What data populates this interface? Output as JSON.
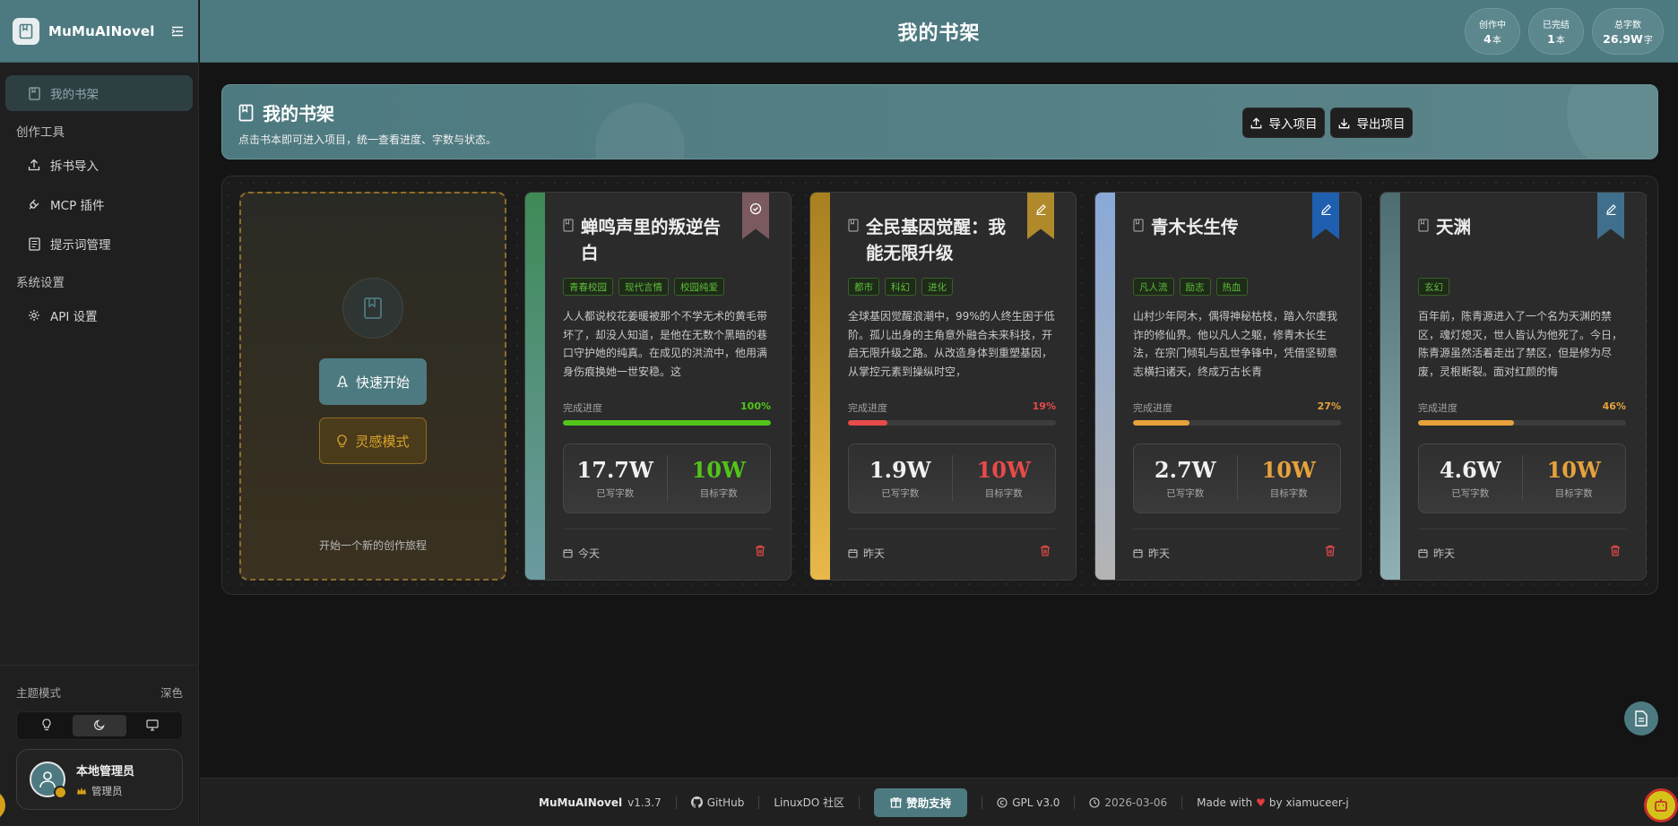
{
  "app": {
    "name": "MuMuAINovel"
  },
  "colors": {
    "primary": "#4d7a80",
    "gold": "#d9a22c",
    "green": "#52c41a",
    "red": "#e84a4a",
    "orange": "#e6a23c"
  },
  "sidebar": {
    "active": {
      "label": "我的书架",
      "icon": "book-icon"
    },
    "groups": [
      {
        "title": "创作工具",
        "items": [
          {
            "label": "拆书导入",
            "icon": "upload-icon"
          },
          {
            "label": "MCP 插件",
            "icon": "plug-icon"
          },
          {
            "label": "提示词管理",
            "icon": "document-icon"
          }
        ]
      },
      {
        "title": "系统设置",
        "items": [
          {
            "label": "API 设置",
            "icon": "gear-icon"
          }
        ]
      }
    ],
    "theme": {
      "label": "主题模式",
      "value": "深色",
      "options": [
        "light-icon",
        "moon-icon",
        "monitor-icon"
      ],
      "selected": 1
    },
    "user": {
      "name": "本地管理员",
      "role": "管理员"
    }
  },
  "header": {
    "title": "我的书架",
    "stats": [
      {
        "label": "创作中",
        "value": "4",
        "unit": "本"
      },
      {
        "label": "已完结",
        "value": "1",
        "unit": "本"
      },
      {
        "label": "总字数",
        "value": "26.9W",
        "unit": "字"
      }
    ]
  },
  "banner": {
    "title": "我的书架",
    "subtitle": "点击书本即可进入项目，统一查看进度、字数与状态。",
    "import_label": "导入项目",
    "export_label": "导出项目"
  },
  "new_card": {
    "quick_start": "快速开始",
    "inspiration": "灵感模式",
    "caption": "开始一个新的创作旅程"
  },
  "books": [
    {
      "title": "蝉鸣声里的叛逆告白",
      "tags": [
        "青春校园",
        "现代言情",
        "校园纯爱"
      ],
      "description": "人人都说校花姜暖被那个不学无术的黄毛带坏了，却没人知道，是他在无数个黑暗的巷口守护她的纯真。在成见的洪流中，他用满身伤痕换她一世安稳。这",
      "progress_label": "完成进度",
      "progress_text": "100%",
      "progress": 1.0,
      "progress_color": "#52c41a",
      "written": "17.7W",
      "written_label": "已写字数",
      "target": "10W",
      "target_label": "目标字数",
      "target_color": "#52c41a",
      "date": "今天",
      "status_icon": "check-circle-icon",
      "ribbon_color": "#7a5a5f",
      "spine": "linear-gradient(180deg,#3f8a57,#6b9aa0)"
    },
    {
      "title": "全民基因觉醒：我能无限升级",
      "tags": [
        "都市",
        "科幻",
        "进化"
      ],
      "description": "全球基因觉醒浪潮中，99%的人终生困于低阶。孤儿出身的主角意外融合未来科技，开启无限升级之路。从改造身体到重塑基因，从掌控元素到操纵时空，",
      "progress_label": "完成进度",
      "progress_text": "19%",
      "progress": 0.19,
      "progress_color": "#e84a4a",
      "written": "1.9W",
      "written_label": "已写字数",
      "target": "10W",
      "target_label": "目标字数",
      "target_color": "#e84a4a",
      "date": "昨天",
      "status_icon": "pencil-icon",
      "ribbon_color": "#b08a2a",
      "spine": "linear-gradient(180deg,#a8801f,#e8b84a)"
    },
    {
      "title": "青木长生传",
      "tags": [
        "凡人流",
        "励志",
        "热血"
      ],
      "description": "山村少年阿木，偶得神秘枯枝，踏入尔虞我诈的修仙界。他以凡人之躯，修青木长生法，在宗门倾轧与乱世争锋中，凭借坚韧意志横扫诸天，终成万古长青",
      "progress_label": "完成进度",
      "progress_text": "27%",
      "progress": 0.27,
      "progress_color": "#e6a23c",
      "written": "2.7W",
      "written_label": "已写字数",
      "target": "10W",
      "target_label": "目标字数",
      "target_color": "#e6a23c",
      "date": "昨天",
      "status_icon": "pencil-icon",
      "ribbon_color": "#1f5fb0",
      "spine": "linear-gradient(180deg,#8aa9d8,#b4b4b4)"
    },
    {
      "title": "天渊",
      "tags": [
        "玄幻"
      ],
      "description": "百年前，陈青源进入了一个名为天渊的禁区，魂灯熄灭，世人皆认为他死了。今日，陈青源虽然活着走出了禁区，但是修为尽废，灵根断裂。面对红颜的悔",
      "progress_label": "完成进度",
      "progress_text": "46%",
      "progress": 0.46,
      "progress_color": "#e6a23c",
      "written": "4.6W",
      "written_label": "已写字数",
      "target": "10W",
      "target_label": "目标字数",
      "target_color": "#e6a23c",
      "date": "昨天",
      "status_icon": "pencil-icon",
      "ribbon_color": "#3f6f8c",
      "spine": "linear-gradient(180deg,#4d6d70,#8fb0b4)"
    }
  ],
  "footer": {
    "brand": "MuMuAINovel",
    "version": "v1.3.7",
    "github": "GitHub",
    "community": "LinuxDO 社区",
    "sponsor": "赞助支持",
    "license": "GPL v3.0",
    "date": "2026-03-06",
    "made_with": "Made with",
    "by": "by xiamuceer-j"
  }
}
